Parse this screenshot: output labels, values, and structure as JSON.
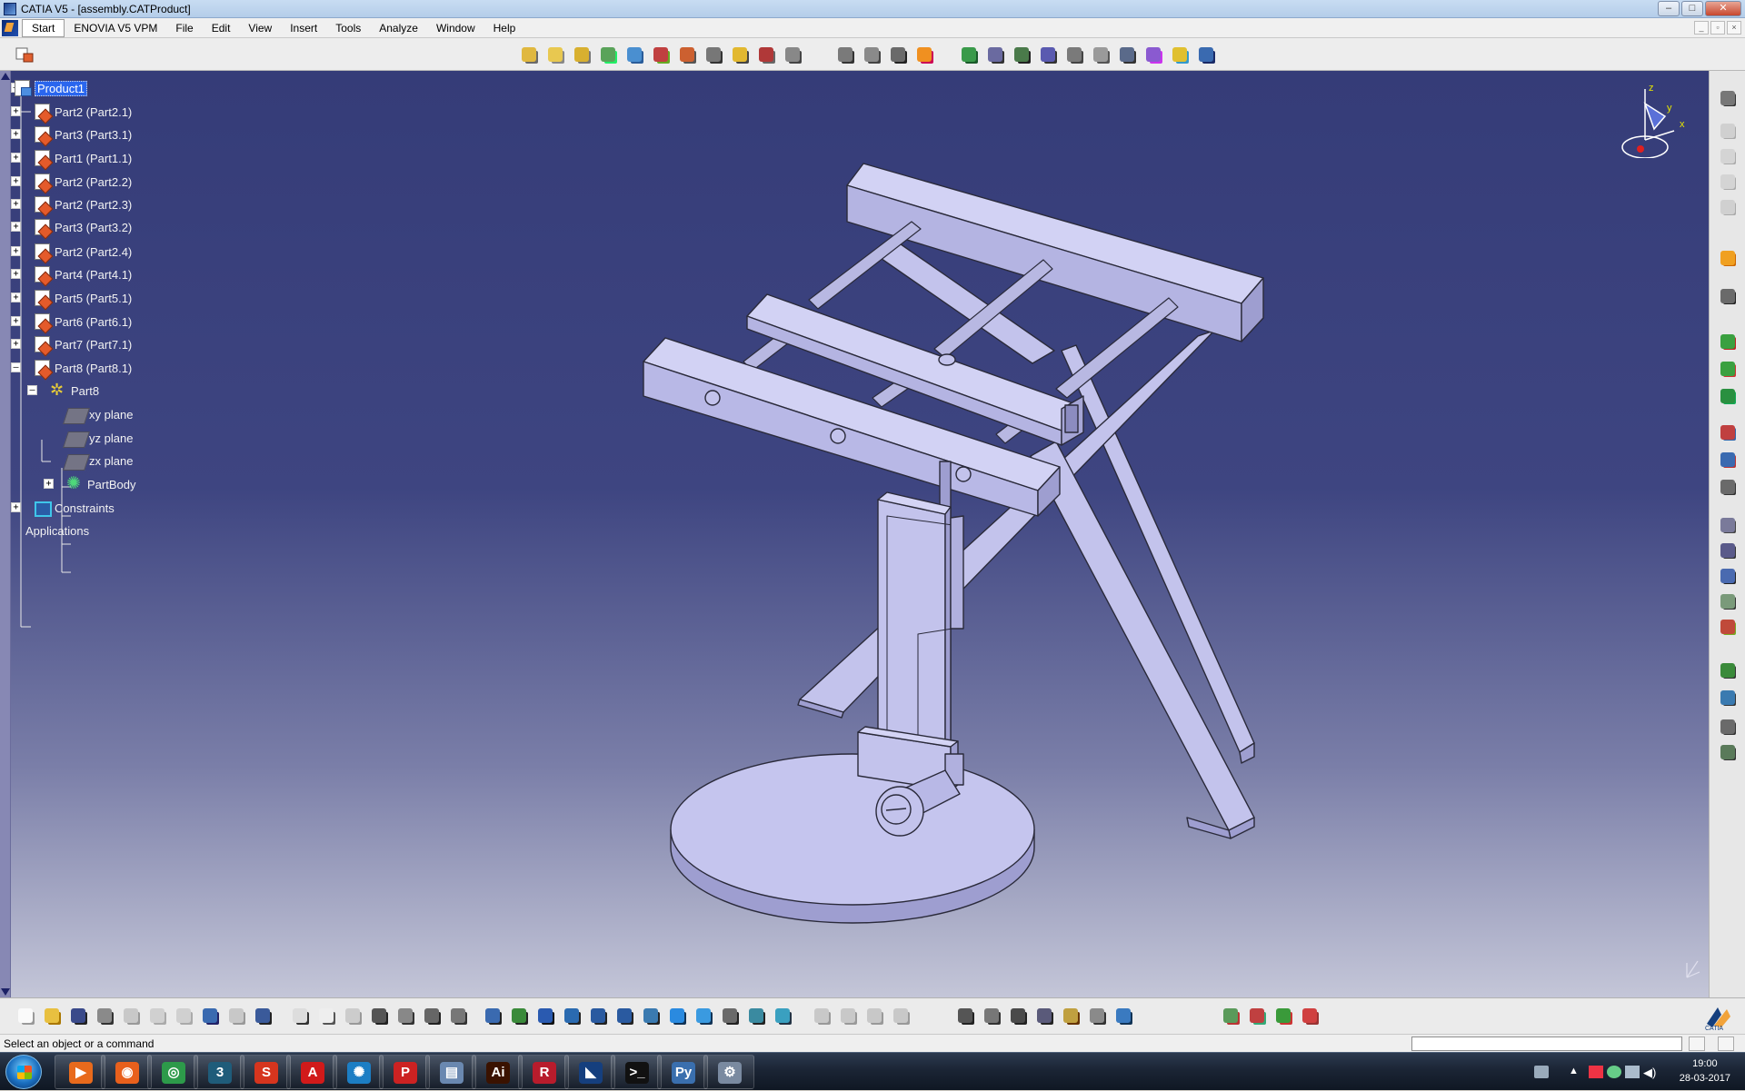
{
  "window": {
    "title": "CATIA V5 - [assembly.CATProduct]",
    "controls": [
      "–",
      "□",
      "✕"
    ]
  },
  "menu": {
    "items": [
      "Start",
      "ENOVIA V5 VPM",
      "File",
      "Edit",
      "View",
      "Insert",
      "Tools",
      "Analyze",
      "Window",
      "Help"
    ],
    "active": "Start",
    "mdi_controls": [
      "_",
      "▫",
      "×"
    ]
  },
  "tree": {
    "nodes": [
      {
        "label": "Product1",
        "type": "product",
        "selected": true,
        "level": 0,
        "expander": "–"
      },
      {
        "label": "Part2 (Part2.1)",
        "type": "part",
        "level": 1,
        "expander": "+"
      },
      {
        "label": "Part3 (Part3.1)",
        "type": "part",
        "level": 1,
        "expander": "+"
      },
      {
        "label": "Part1 (Part1.1)",
        "type": "part",
        "level": 1,
        "expander": "+"
      },
      {
        "label": "Part2 (Part2.2)",
        "type": "part",
        "level": 1,
        "expander": "+"
      },
      {
        "label": "Part2 (Part2.3)",
        "type": "part",
        "level": 1,
        "expander": "+"
      },
      {
        "label": "Part3 (Part3.2)",
        "type": "part",
        "level": 1,
        "expander": "+"
      },
      {
        "label": "Part2 (Part2.4)",
        "type": "part",
        "level": 1,
        "expander": "+"
      },
      {
        "label": "Part4 (Part4.1)",
        "type": "part",
        "level": 1,
        "expander": "+"
      },
      {
        "label": "Part5 (Part5.1)",
        "type": "part",
        "level": 1,
        "expander": "+"
      },
      {
        "label": "Part6 (Part6.1)",
        "type": "part",
        "level": 1,
        "expander": "+"
      },
      {
        "label": "Part7 (Part7.1)",
        "type": "part",
        "level": 1,
        "expander": "+"
      },
      {
        "label": "Part8 (Part8.1)",
        "type": "part",
        "level": 1,
        "expander": "–"
      },
      {
        "label": "Part8",
        "type": "gear",
        "level": 2,
        "expander": "–"
      },
      {
        "label": "xy plane",
        "type": "plane",
        "level": 3,
        "expander": ""
      },
      {
        "label": "yz plane",
        "type": "plane",
        "level": 3,
        "expander": ""
      },
      {
        "label": "zx plane",
        "type": "plane",
        "level": 3,
        "expander": ""
      },
      {
        "label": "PartBody",
        "type": "body",
        "level": 3,
        "expander": "+"
      },
      {
        "label": "Constraints",
        "type": "constraints",
        "level": 1,
        "expander": "+"
      },
      {
        "label": "Applications",
        "type": "none",
        "level": 1,
        "expander": ""
      }
    ]
  },
  "compass": {
    "axes": [
      "z",
      "y",
      "x"
    ]
  },
  "status": {
    "text": "Select an object or a command"
  },
  "colors": {
    "viewport_top": "#353c78",
    "viewport_bottom": "#c4c6d8",
    "model_face": "#c3c3ec",
    "model_side": "#9e9ed0",
    "model_edge": "#2a2a3a",
    "selection": "#2a66ee"
  },
  "taskbar": {
    "apps": [
      {
        "name": "windows-media-player",
        "glyph": "▶",
        "color": "#e86a1c"
      },
      {
        "name": "firefox",
        "glyph": "◉",
        "color": "#e8601c"
      },
      {
        "name": "chrome",
        "glyph": "◎",
        "color": "#2d9a4a"
      },
      {
        "name": "3ds-max",
        "glyph": "3",
        "color": "#1f5c7a"
      },
      {
        "name": "sketchup",
        "glyph": "S",
        "color": "#d6351e"
      },
      {
        "name": "acrobat",
        "glyph": "A",
        "color": "#d11a1a"
      },
      {
        "name": "photo-app",
        "glyph": "✺",
        "color": "#1c7ec4"
      },
      {
        "name": "pdf-reader",
        "glyph": "P",
        "color": "#cc2222"
      },
      {
        "name": "scanner",
        "glyph": "▤",
        "color": "#6a88b0"
      },
      {
        "name": "illustrator",
        "glyph": "Ai",
        "color": "#3a1200"
      },
      {
        "name": "revit",
        "glyph": "R",
        "color": "#b81c2c"
      },
      {
        "name": "catia",
        "glyph": "◣",
        "color": "#153f7e"
      },
      {
        "name": "command-prompt",
        "glyph": ">_",
        "color": "#111111"
      },
      {
        "name": "python",
        "glyph": "Py",
        "color": "#3a6fae"
      },
      {
        "name": "settings",
        "glyph": "⚙",
        "color": "#7a8aa0"
      }
    ],
    "clock": {
      "time": "19:00",
      "date": "28-03-2017"
    }
  }
}
